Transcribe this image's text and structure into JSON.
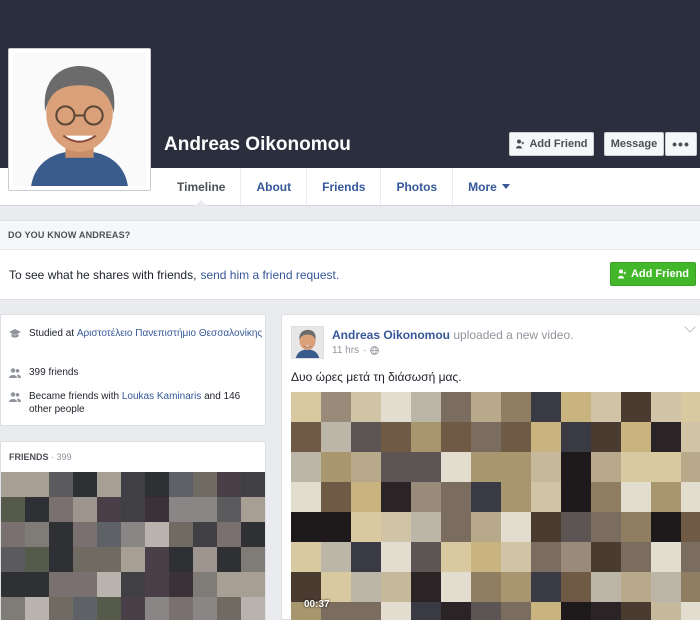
{
  "profile": {
    "name": "Andreas Oikonomou",
    "actions": {
      "add_friend": "Add Friend",
      "message": "Message",
      "more": "•••"
    }
  },
  "tabs": [
    {
      "label": "Timeline"
    },
    {
      "label": "About"
    },
    {
      "label": "Friends"
    },
    {
      "label": "Photos"
    },
    {
      "label": "More"
    }
  ],
  "know_prompt": {
    "heading": "DO YOU KNOW ANDREAS?",
    "text": "To see what he shares with friends,",
    "link": "send him a friend request.",
    "button": "Add Friend"
  },
  "intro": {
    "studied_prefix": "Studied at",
    "school": "Αριστοτέλειο Πανεπιστήμιο Θεσσαλονίκης",
    "friends_count": "399 friends",
    "became_prefix": "Became friends with",
    "became_friend": "Loukas Kaminaris",
    "became_suffix": "and 146 other people"
  },
  "friends_box": {
    "title": "FRIENDS",
    "separator": " · ",
    "count": "399"
  },
  "post": {
    "author": "Andreas Oikonomou",
    "action": "uploaded a new video.",
    "time": "11 hrs",
    "separator": "·",
    "text": "Δυο ώρες μετά τη διάσωσή μας.",
    "video_duration": "00:37"
  },
  "colors": {
    "cover": "#2b2e3d",
    "link": "#365899",
    "accent_green": "#42b72a",
    "page_bg": "#e9ebee"
  },
  "icons": {
    "add_friend": "person-plus-icon",
    "school": "graduation-cap-icon",
    "friends": "people-icon",
    "privacy": "globe-icon",
    "post_menu": "chevron-down-icon"
  }
}
